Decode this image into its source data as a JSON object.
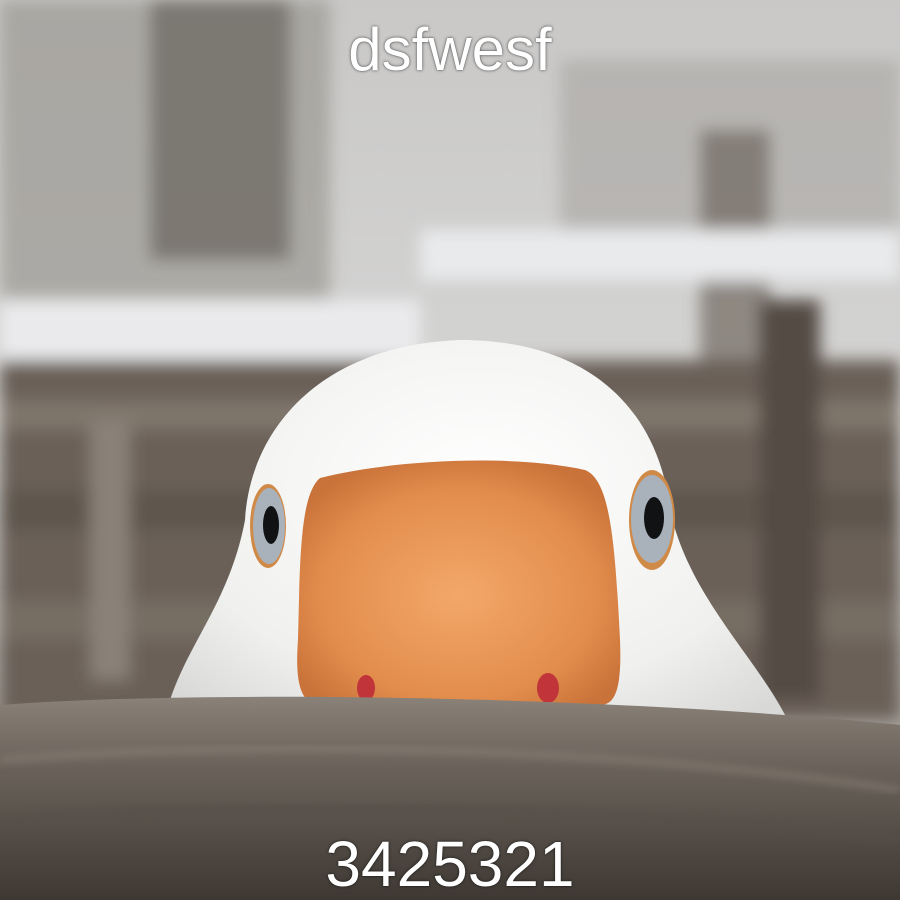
{
  "meme": {
    "top_text": "dsfwesf",
    "bottom_text": "3425321"
  },
  "colors": {
    "sky": "#d9d9d8",
    "snow": "#ecedef",
    "fence": "#6b6158",
    "goose_white": "#f4f4f2",
    "beak": "#e3904f",
    "eye": "#a9b1bb"
  }
}
